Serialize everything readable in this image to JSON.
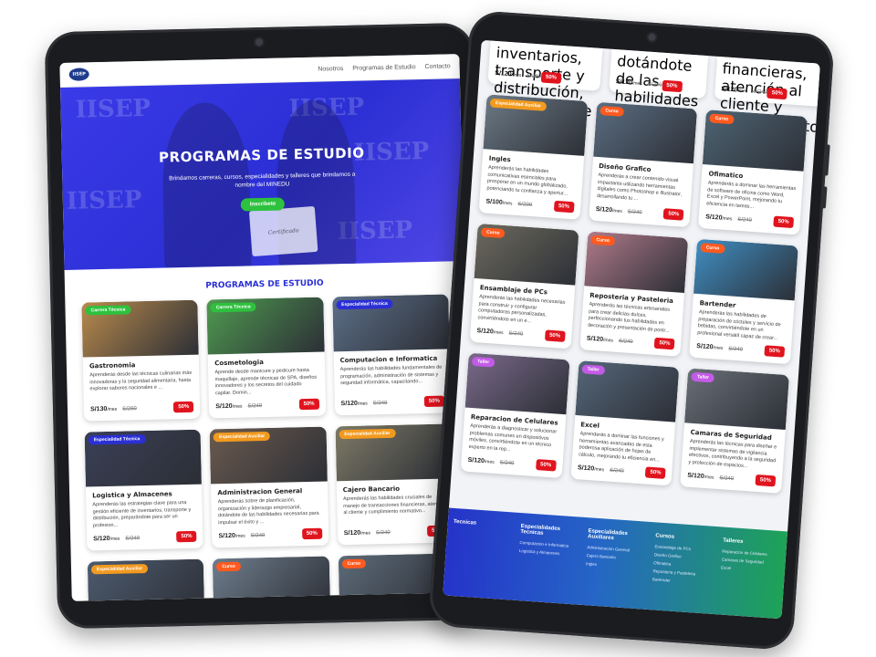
{
  "site": {
    "nav": [
      "Nosotros",
      "Programas de Estudio",
      "Contacto"
    ],
    "logo_text": "IISEP"
  },
  "hero": {
    "title": "PROGRAMAS DE ESTUDIO",
    "subtitle": "Brindamos carreras, cursos, especialidades y talleres que brindamos a nombre del MINEDU",
    "cta": "Inscribete",
    "watermark": "IISEP",
    "certificate": "Certificado"
  },
  "section_title": "PROGRAMAS DE ESTUDIO",
  "left_cards": [
    {
      "badge": "Carrera Técnica",
      "badge_color": "#2ec13e",
      "title": "Gastronomia",
      "desc": "Aprenderás desde las técnicas culinarias más innovadoras y la seguridad alimentaria, hasta explorar sabores nacionales e ...",
      "price": "S/130",
      "per": "/mes",
      "old": "S/260",
      "off": "50%",
      "img": "#b98a4c"
    },
    {
      "badge": "Carrera Técnica",
      "badge_color": "#2ec13e",
      "title": "Cosmetologia",
      "desc": "Aprende desde manicure y pedicure hasta maquillaje, aprende técnicas de SPA, diseños innovadores y los secretos del cuidado capilar. Domin...",
      "price": "S/120",
      "per": "/mes",
      "old": "S/240",
      "off": "50%",
      "img": "#4f9a50"
    },
    {
      "badge": "Especialidad Técnica",
      "badge_color": "#2b2fd4",
      "title": "Computacion e Informatica",
      "desc": "Aprenderás las habilidades fundamentales de programación, administración de sistemas y seguridad informática, capacitando...",
      "price": "S/120",
      "per": "/mes",
      "old": "S/240",
      "off": "50%",
      "img": "#5c6f88"
    },
    {
      "badge": "Especialidad Técnica",
      "badge_color": "#2b2fd4",
      "title": "Logistica y Almacenes",
      "desc": "Aprenderás las estrategias clave para una gestión eficiente de inventarios, transporte y distribución, preparándote para ser un profesion...",
      "price": "S/120",
      "per": "/mes",
      "old": "S/240",
      "off": "50%",
      "img": "#3a3f56"
    },
    {
      "badge": "Especialidad Auxiliar",
      "badge_color": "#f29a1f",
      "title": "Administracion General",
      "desc": "Aprenderás sobre de planificación, organización y liderazgo empresarial, dotándote de las habilidades necesarias para impulsar el éxito y ...",
      "price": "S/120",
      "per": "/mes",
      "old": "S/240",
      "off": "50%",
      "img": "#6b5a4e"
    },
    {
      "badge": "Especialidad Auxiliar",
      "badge_color": "#f29a1f",
      "title": "Cajero Bancario",
      "desc": "Aprenderás las habilidades cruciales de manejo de transacciones financieras, atención al cliente y cumplimiento normativo...",
      "price": "S/120",
      "per": "/mes",
      "old": "S/240",
      "off": "50%",
      "img": "#7e7a66"
    },
    {
      "badge": "Especialidad Auxiliar",
      "badge_color": "#f29a1f",
      "title": "",
      "desc": "",
      "price": "",
      "per": "",
      "old": "",
      "off": "",
      "img": "#4d5b6e"
    },
    {
      "badge": "Curso",
      "badge_color": "#ff5a1f",
      "title": "",
      "desc": "",
      "price": "",
      "per": "",
      "old": "",
      "off": "",
      "img": "#6e7d8c"
    },
    {
      "badge": "Curso",
      "badge_color": "#ff5a1f",
      "title": "",
      "desc": "",
      "price": "",
      "per": "",
      "old": "",
      "off": "",
      "img": "#5d6b79"
    }
  ],
  "right_top": [
    {
      "desc": "inventarios, transporte y distribución, preparándote para ser un profesion...",
      "price": "S/120",
      "per": "/mes",
      "old": "S/240",
      "off": "50%"
    },
    {
      "desc": "dotándote de las habilidades necesarias para impulsar el éxito y ...",
      "price": "S/120",
      "per": "/mes",
      "old": "S/240",
      "off": "50%"
    },
    {
      "desc": "financieras, atención al cliente y cumplimiento normativo...",
      "price": "S/120",
      "per": "/mes",
      "old": "S/240",
      "off": "50%"
    }
  ],
  "right_cards": [
    {
      "badge": "Especialidad Auxiliar",
      "badge_color": "#f29a1f",
      "title": "Ingles",
      "desc": "Aprenderás las habilidades comunicativas esenciales para prosperar en un mundo globalizado, potenciando tu confianza y apertur...",
      "price": "S/100",
      "per": "/mes",
      "old": "S/200",
      "off": "50%",
      "img": "#6c7a86"
    },
    {
      "badge": "Curso",
      "badge_color": "#ff5a1f",
      "title": "Diseño Grafico",
      "desc": "Aprenderás a crear contenido visual impactante utilizando herramientas digitales como Photoshop e Illustrator, desarrollando tu ...",
      "price": "S/120",
      "per": "/mes",
      "old": "S/240",
      "off": "50%",
      "img": "#5b6e82"
    },
    {
      "badge": "Curso",
      "badge_color": "#ff5a1f",
      "title": "Ofimatico",
      "desc": "Aprenderás a dominar las herramientas de software de oficina como Word, Excel y PowerPoint, mejorando tu eficiencia en tareas...",
      "price": "S/120",
      "per": "/mes",
      "old": "S/240",
      "off": "50%",
      "img": "#4e6473"
    },
    {
      "badge": "Curso",
      "badge_color": "#ff5a1f",
      "title": "Ensamblaje de PCs",
      "desc": "Aprenderás las habilidades necesarias para construir y configurar computadoras personalizadas, convirtiéndote en un e...",
      "price": "S/120",
      "per": "/mes",
      "old": "S/240",
      "off": "50%",
      "img": "#6d6a5d"
    },
    {
      "badge": "Curso",
      "badge_color": "#ff5a1f",
      "title": "Reposteria y Pasteleria",
      "desc": "Aprenderás las técnicas artesanales para crear delicias dulces, perfeccionando tus habilidades en decoración y presentación de postr...",
      "price": "S/120",
      "per": "/mes",
      "old": "S/240",
      "off": "50%",
      "img": "#b07a8a"
    },
    {
      "badge": "Curso",
      "badge_color": "#ff5a1f",
      "title": "Bartender",
      "desc": "Aprenderás las habilidades de preparación de cócteles y servicio de bebidas, convirtiéndote en un profesional versátil capaz de crear...",
      "price": "S/120",
      "per": "/mes",
      "old": "S/240",
      "off": "50%",
      "img": "#3f8fc4"
    },
    {
      "badge": "Taller",
      "badge_color": "#c45be8",
      "title": "Reparacion de Celulares",
      "desc": "Aprenderás a diagnosticar y solucionar problemas comunes en dispositivos móviles, convirtiéndote en un técnico experto en la rep...",
      "price": "S/120",
      "per": "/mes",
      "old": "S/240",
      "off": "50%",
      "img": "#7a6a8a"
    },
    {
      "badge": "Taller",
      "badge_color": "#c45be8",
      "title": "Excel",
      "desc": "Aprenderás a dominar las funciones y herramientas avanzadas de esta poderosa aplicación de hojas de cálculo, mejorando tu eficiencia en...",
      "price": "S/120",
      "per": "/mes",
      "old": "S/240",
      "off": "50%",
      "img": "#55677a"
    },
    {
      "badge": "Taller",
      "badge_color": "#c45be8",
      "title": "Camaras de Seguridad",
      "desc": "Aprenderás las técnicas para diseñar e implementar sistemas de vigilancia efectivos, contribuyendo a la seguridad y protección de espacios...",
      "price": "S/120",
      "per": "/mes",
      "old": "S/240",
      "off": "50%",
      "img": "#6a6f78"
    }
  ],
  "footer": [
    {
      "title": "Tecnicas",
      "items": [
        ""
      ]
    },
    {
      "title": "Especialidades Tecnicas",
      "items": [
        "Computacion e Informatica",
        "Logistica y Almacenes"
      ]
    },
    {
      "title": "Especialidades Auxiliares",
      "items": [
        "Administracion General",
        "Cajero Bancario",
        "Ingles"
      ]
    },
    {
      "title": "Cursos",
      "items": [
        "Ensamblaje de PCs",
        "Diseño Grafico",
        "Ofimatica",
        "Reposteria y Pasteleria",
        "Bartender"
      ]
    },
    {
      "title": "Talleres",
      "items": [
        "Reparacion de Celulares",
        "Camaras de Seguridad",
        "Excel"
      ]
    }
  ]
}
